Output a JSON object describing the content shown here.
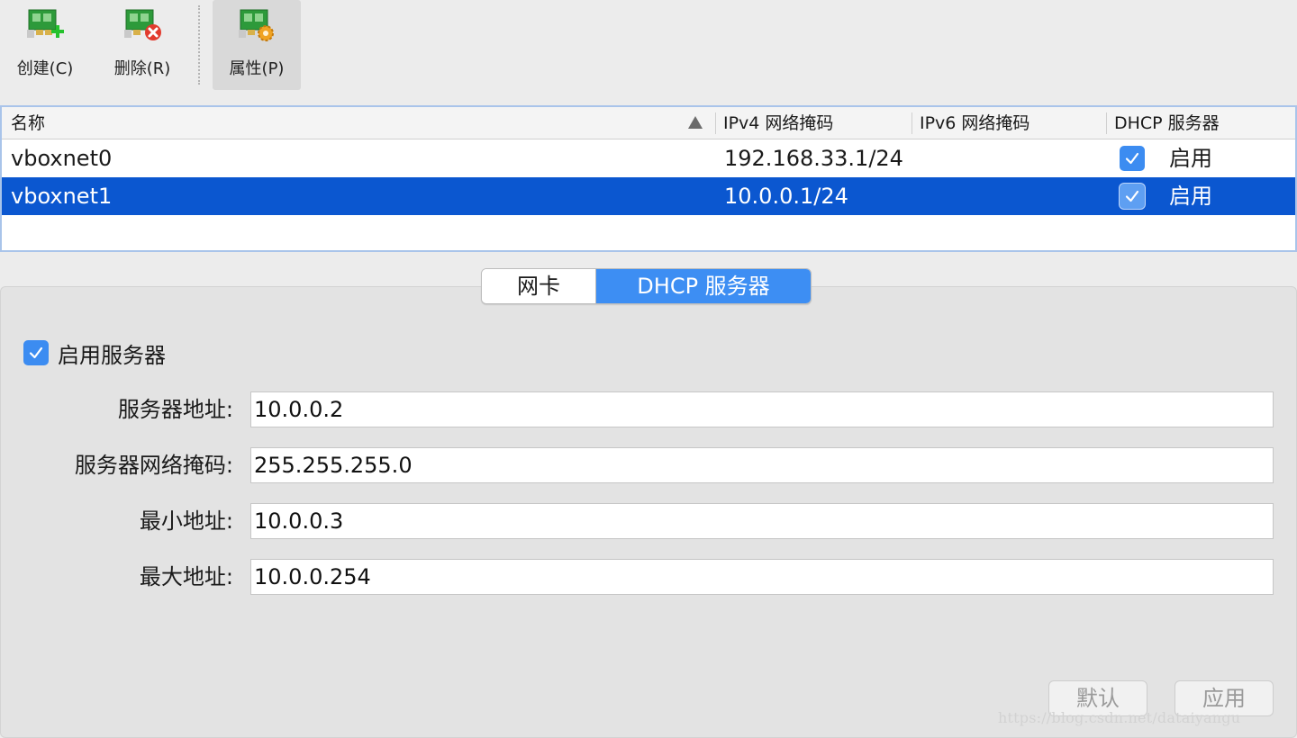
{
  "toolbar": {
    "items": [
      {
        "label": "创建(C)",
        "icon": "network-card-add-icon"
      },
      {
        "label": "删除(R)",
        "icon": "network-card-remove-icon"
      },
      {
        "label": "属性(P)",
        "icon": "network-card-properties-icon",
        "active": true
      }
    ]
  },
  "table": {
    "headers": {
      "name": "名称",
      "ipv4": "IPv4 网络掩码",
      "ipv6": "IPv6 网络掩码",
      "dhcp": "DHCP 服务器"
    },
    "rows": [
      {
        "name": "vboxnet0",
        "ipv4": "192.168.33.1/24",
        "ipv6": "",
        "dhcp": "启用",
        "dhcp_checked": true,
        "selected": false
      },
      {
        "name": "vboxnet1",
        "ipv4": "10.0.0.1/24",
        "ipv6": "",
        "dhcp": "启用",
        "dhcp_checked": true,
        "selected": true
      }
    ]
  },
  "tabs": [
    {
      "label": "网卡",
      "active": false
    },
    {
      "label": "DHCP 服务器",
      "active": true
    }
  ],
  "dhcp": {
    "enable_label": "启用服务器",
    "enabled": true,
    "fields": [
      {
        "label": "服务器地址:",
        "value": "10.0.0.2"
      },
      {
        "label": "服务器网络掩码:",
        "value": "255.255.255.0"
      },
      {
        "label": "最小地址:",
        "value": "10.0.0.3"
      },
      {
        "label": "最大地址:",
        "value": "10.0.0.254"
      }
    ],
    "buttons": {
      "default": "默认",
      "apply": "应用"
    }
  },
  "watermark": "https://blog.csdn.net/dataiyangu",
  "colors": {
    "selection": "#0b57d0",
    "accent": "#3c8cf1",
    "active_tab": "#3d8ef3"
  }
}
